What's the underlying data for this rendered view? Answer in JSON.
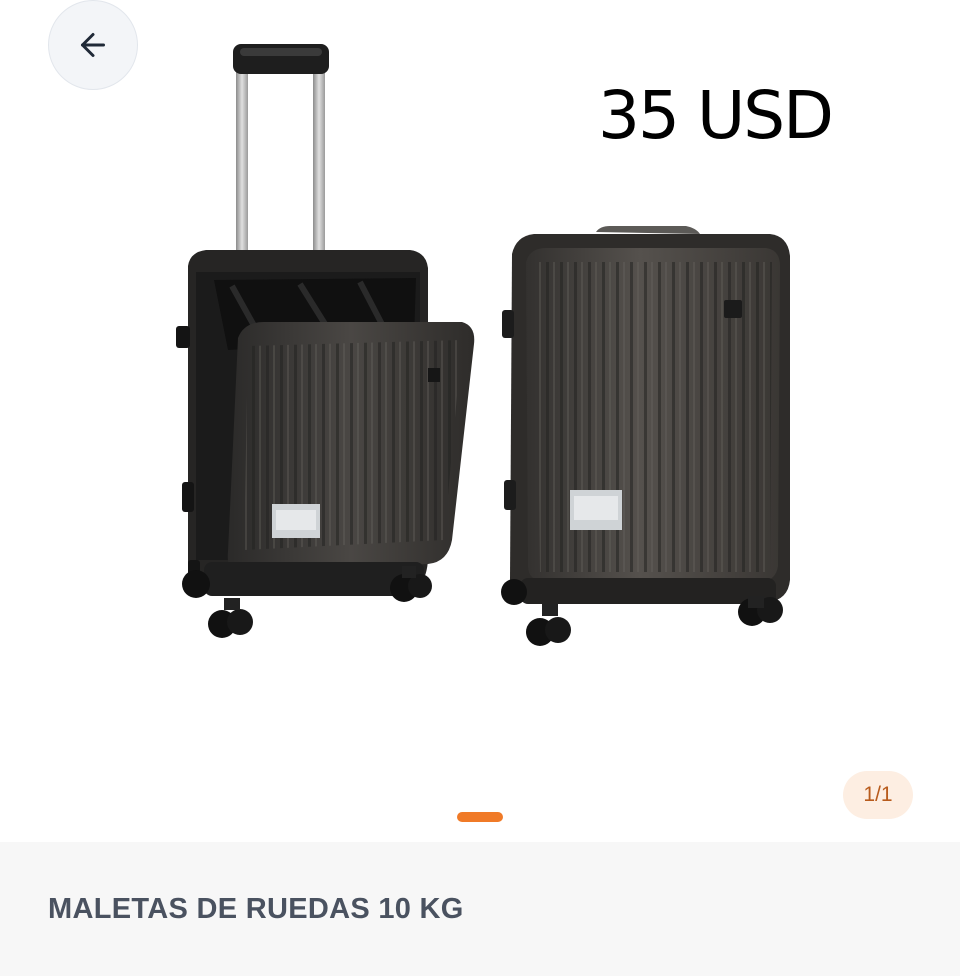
{
  "header": {
    "back_icon": "arrow-left-icon"
  },
  "gallery": {
    "price_overlay": "35 USD",
    "page_counter": "1/1",
    "current_page": 1,
    "total_pages": 1,
    "indicator_color": "#f07a27",
    "image_description": "two dark grey hard-shell carry-on suitcases with extended telescopic handle and spinner wheels"
  },
  "product": {
    "title": "MALETAS DE RUEDAS 10 KG"
  },
  "colors": {
    "accent": "#f07a27",
    "counter_bg": "#fdeee2",
    "counter_text": "#b85b1c",
    "title_text": "#4a5260",
    "panel_bg": "#f7f7f7"
  }
}
